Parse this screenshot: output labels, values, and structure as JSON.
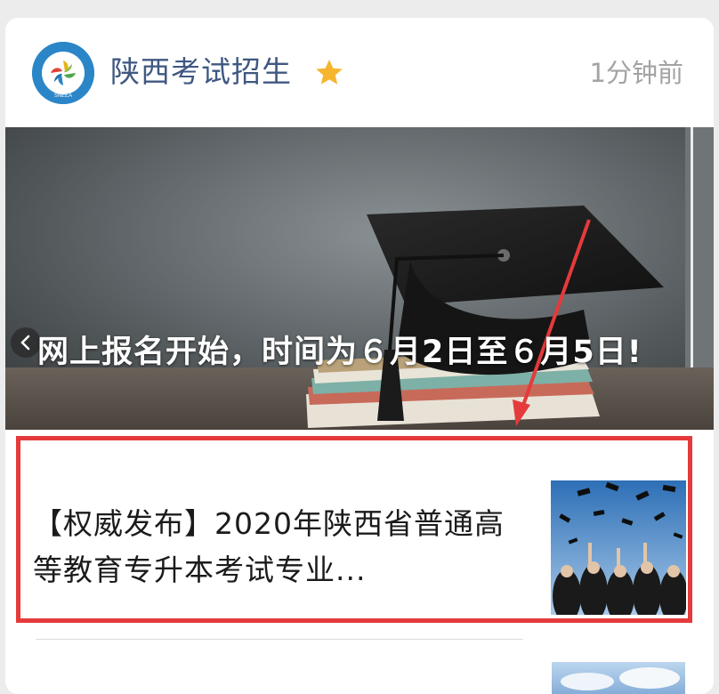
{
  "account": {
    "name": "陕西考试招生",
    "verified_icon": "star-icon",
    "timestamp": "1分钟前",
    "logo_text": "陕西省教育考试院",
    "logo_abbr": "SNEEA"
  },
  "banner": {
    "title": "网上报名开始，时间为６月2日至６月5日!",
    "prev_icon": "chevron-left-icon"
  },
  "article": {
    "title": "【权威发布】2020年陕西省普通高等教育专升本考试专业..."
  },
  "colors": {
    "accent_red": "#e53a3b",
    "name_blue": "#3f5882",
    "star_gold": "#f5b52e"
  }
}
